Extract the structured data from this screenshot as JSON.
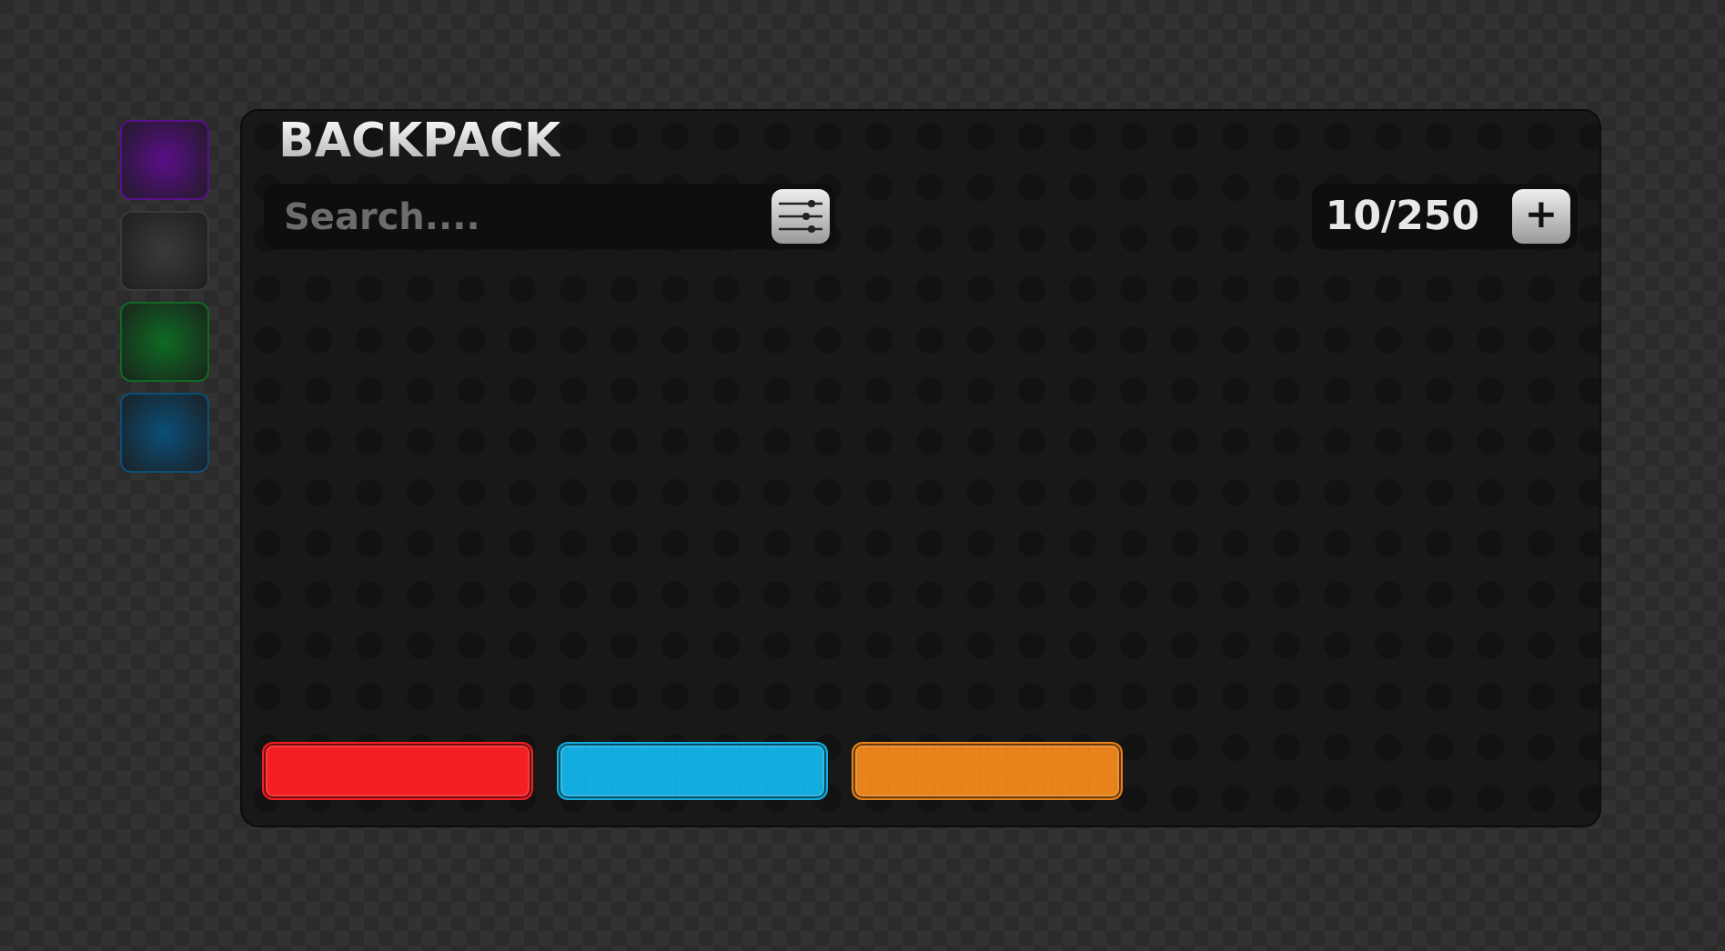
{
  "side_tabs": [
    {
      "color": "#5a0f8a"
    },
    {
      "color": "#3a3a3a"
    },
    {
      "color": "#0e6a22"
    },
    {
      "color": "#0b4e78"
    }
  ],
  "panel": {
    "title": "BACKPACK",
    "search": {
      "placeholder": "Search...."
    },
    "capacity": "10/250",
    "add_button": "+"
  },
  "action_buttons": [
    {
      "color": "#f41f22"
    },
    {
      "color": "#13ade0"
    },
    {
      "color": "#e8821a"
    }
  ]
}
